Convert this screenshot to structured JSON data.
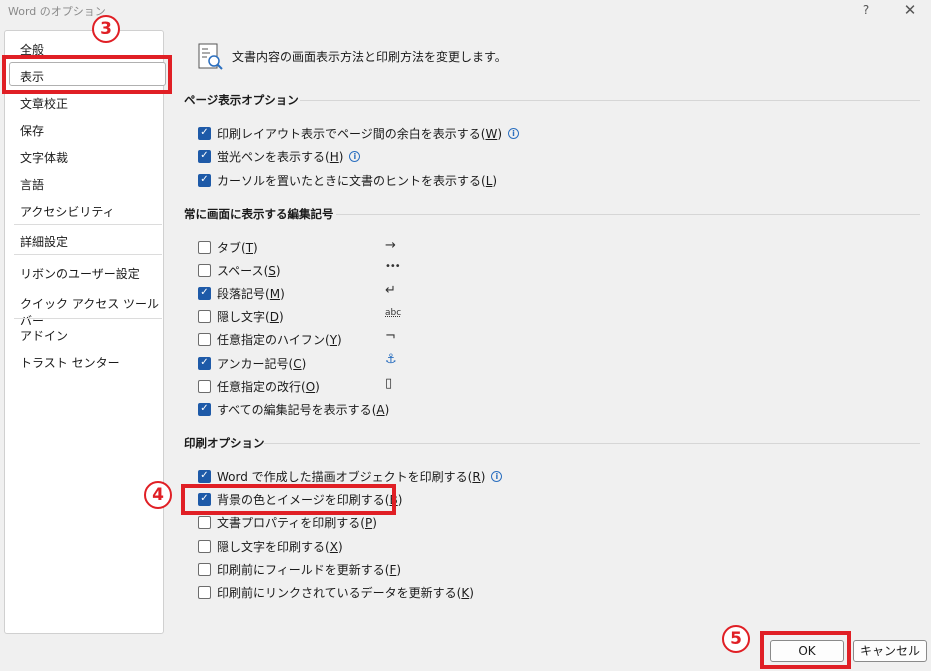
{
  "window": {
    "title": "Word のオプション",
    "help_glyph": "?",
    "close_glyph": "✕"
  },
  "sidebar": {
    "items": [
      {
        "label": "全般"
      },
      {
        "label": "表示"
      },
      {
        "label": "文章校正"
      },
      {
        "label": "保存"
      },
      {
        "label": "文字体裁"
      },
      {
        "label": "言語"
      },
      {
        "label": "アクセシビリティ"
      },
      {
        "label": "詳細設定"
      },
      {
        "label": "リボンのユーザー設定"
      },
      {
        "label": "クイック アクセス ツール バー"
      },
      {
        "label": "アドイン"
      },
      {
        "label": "トラスト センター"
      }
    ],
    "selected": "表示"
  },
  "annotations": {
    "step3": "3",
    "step4": "4",
    "step5": "5",
    "accent_color": "#e01f25"
  },
  "main": {
    "header_text": "文書内容の画面表示方法と印刷方法を変更します。",
    "sections": [
      {
        "title": "ページ表示オプション",
        "items": [
          {
            "label": "印刷レイアウト表示でページ間の余白を表示する",
            "key": "W",
            "checked": true,
            "info": true
          },
          {
            "label": "蛍光ペンを表示する",
            "key": "H",
            "checked": true,
            "info": true
          },
          {
            "label": "カーソルを置いたときに文書のヒントを表示する",
            "key": "L",
            "checked": true,
            "info": false
          }
        ]
      },
      {
        "title": "常に画面に表示する編集記号",
        "items": [
          {
            "label": "タブ",
            "key": "T",
            "checked": false,
            "mark": "→"
          },
          {
            "label": "スペース",
            "key": "S",
            "checked": false,
            "mark": "•••"
          },
          {
            "label": "段落記号",
            "key": "M",
            "checked": true,
            "mark": "↵"
          },
          {
            "label": "隠し文字",
            "key": "D",
            "checked": false,
            "mark": "abc"
          },
          {
            "label": "任意指定のハイフン",
            "key": "Y",
            "checked": false,
            "mark": "¬"
          },
          {
            "label": "アンカー記号",
            "key": "C",
            "checked": true,
            "mark": "⚓"
          },
          {
            "label": "任意指定の改行",
            "key": "O",
            "checked": false,
            "mark": "▯"
          },
          {
            "label": "すべての編集記号を表示する",
            "key": "A",
            "checked": true
          }
        ]
      },
      {
        "title": "印刷オプション",
        "items": [
          {
            "label": "Word で作成した描画オブジェクトを印刷する",
            "key": "R",
            "checked": true,
            "info": true
          },
          {
            "label": "背景の色とイメージを印刷する",
            "key": "B",
            "checked": true
          },
          {
            "label": "文書プロパティを印刷する",
            "key": "P",
            "checked": false
          },
          {
            "label": "隠し文字を印刷する",
            "key": "X",
            "checked": false
          },
          {
            "label": "印刷前にフィールドを更新する",
            "key": "F",
            "checked": false
          },
          {
            "label": "印刷前にリンクされているデータを更新する",
            "key": "K",
            "checked": false
          }
        ]
      }
    ]
  },
  "buttons": {
    "ok": "OK",
    "cancel": "キャンセル"
  },
  "icons": {
    "header_icon": "display-settings-icon",
    "info_icon": "info-icon"
  }
}
